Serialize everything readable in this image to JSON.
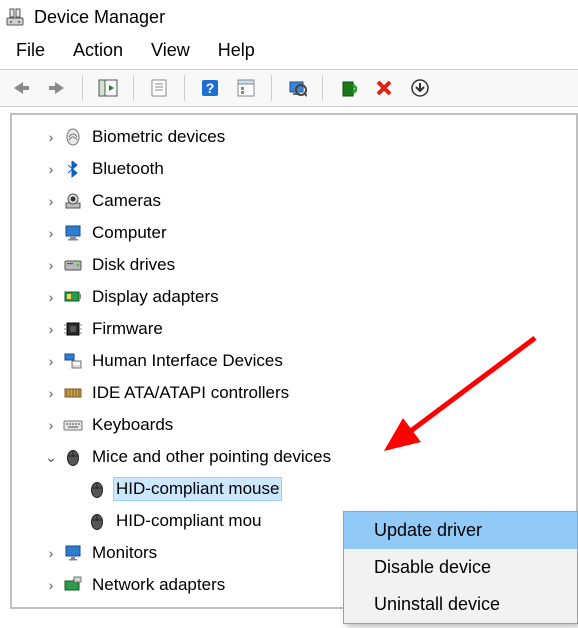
{
  "window": {
    "title": "Device Manager"
  },
  "menubar": {
    "items": [
      "File",
      "Action",
      "View",
      "Help"
    ]
  },
  "toolbar": {
    "buttons": [
      "back-icon",
      "forward-icon",
      "sep",
      "show-hide-tree-icon",
      "sep",
      "help-properties-icon",
      "sep",
      "help-icon",
      "properties-icon",
      "sep",
      "scan-hardware-icon",
      "sep",
      "update-driver-icon",
      "uninstall-icon",
      "more-actions-icon"
    ]
  },
  "tree": {
    "nodes": [
      {
        "label": "Biometric devices",
        "expanded": false,
        "icon": "fingerprint"
      },
      {
        "label": "Bluetooth",
        "expanded": false,
        "icon": "bluetooth"
      },
      {
        "label": "Cameras",
        "expanded": false,
        "icon": "camera"
      },
      {
        "label": "Computer",
        "expanded": false,
        "icon": "computer"
      },
      {
        "label": "Disk drives",
        "expanded": false,
        "icon": "disk"
      },
      {
        "label": "Display adapters",
        "expanded": false,
        "icon": "display-adapter"
      },
      {
        "label": "Firmware",
        "expanded": false,
        "icon": "chip"
      },
      {
        "label": "Human Interface Devices",
        "expanded": false,
        "icon": "hid"
      },
      {
        "label": "IDE ATA/ATAPI controllers",
        "expanded": false,
        "icon": "ide"
      },
      {
        "label": "Keyboards",
        "expanded": false,
        "icon": "keyboard"
      },
      {
        "label": "Mice and other pointing devices",
        "expanded": true,
        "icon": "mouse",
        "children": [
          {
            "label": "HID-compliant mouse",
            "icon": "mouse",
            "selected": true
          },
          {
            "label": "HID-compliant mouse",
            "icon": "mouse",
            "selected": false,
            "truncatedTo": "HID-compliant mou"
          }
        ]
      },
      {
        "label": "Monitors",
        "expanded": false,
        "icon": "monitor"
      },
      {
        "label": "Network adapters",
        "expanded": false,
        "icon": "network"
      }
    ]
  },
  "context_menu": {
    "items": [
      {
        "label": "Update driver",
        "highlight": true
      },
      {
        "label": "Disable device",
        "highlight": false
      },
      {
        "label": "Uninstall device",
        "highlight": false
      }
    ]
  },
  "annotation": {
    "type": "arrow",
    "color": "#ff0000"
  }
}
